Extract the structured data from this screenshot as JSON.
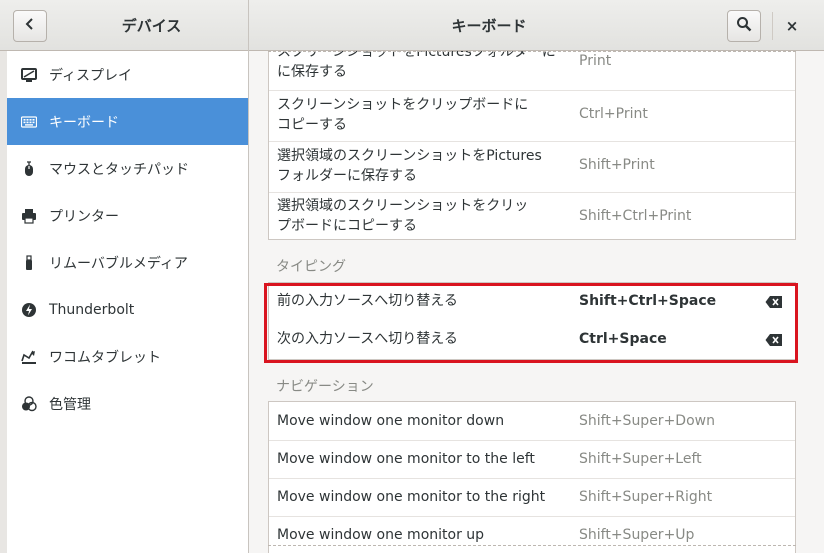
{
  "header": {
    "left_title": "デバイス",
    "main_title": "キーボード",
    "back_icon": "chevron-left-icon",
    "search_icon": "search-icon",
    "close_label": "×"
  },
  "sidebar": {
    "items": [
      {
        "label": "ディスプレイ",
        "icon": "display-icon"
      },
      {
        "label": "キーボード",
        "icon": "keyboard-icon",
        "active": true
      },
      {
        "label": "マウスとタッチパッド",
        "icon": "mouse-icon"
      },
      {
        "label": "プリンター",
        "icon": "printer-icon"
      },
      {
        "label": "リムーバブルメディア",
        "icon": "usb-icon"
      },
      {
        "label": "Thunderbolt",
        "icon": "thunderbolt-icon"
      },
      {
        "label": "ワコムタブレット",
        "icon": "tablet-icon"
      },
      {
        "label": "色管理",
        "icon": "color-icon"
      }
    ]
  },
  "screenshots": {
    "rows": [
      {
        "name_l1": "スクリーンショットをPicturesフォルダーに",
        "name_l2": "に保存する",
        "accel": "Print"
      },
      {
        "name_l1": "スクリーンショットをクリップボードに",
        "name_l2": "コピーする",
        "accel": "Ctrl+Print"
      },
      {
        "name_l1": "選択領域のスクリーンショットをPictures",
        "name_l2": "フォルダーに保存する",
        "accel": "Shift+Print"
      },
      {
        "name_l1": "選択領域のスクリーンショットをクリッ",
        "name_l2": "プボードにコピーする",
        "accel": "Shift+Ctrl+Print"
      }
    ]
  },
  "typing": {
    "title": "タイピング",
    "rows": [
      {
        "name": "前の入力ソースへ切り替える",
        "accel": "Shift+Ctrl+Space"
      },
      {
        "name": "次の入力ソースへ切り替える",
        "accel": "Ctrl+Space"
      }
    ]
  },
  "navigation": {
    "title": "ナビゲーション",
    "rows": [
      {
        "name": "Move window one monitor down",
        "accel": "Shift+Super+Down"
      },
      {
        "name": "Move window one monitor to the left",
        "accel": "Shift+Super+Left"
      },
      {
        "name": "Move window one monitor to the right",
        "accel": "Shift+Super+Right"
      },
      {
        "name": "Move window one monitor up",
        "accel": "Shift+Super+Up"
      }
    ]
  },
  "colors": {
    "accent": "#4a90d9",
    "highlight_border": "#d9141f"
  }
}
